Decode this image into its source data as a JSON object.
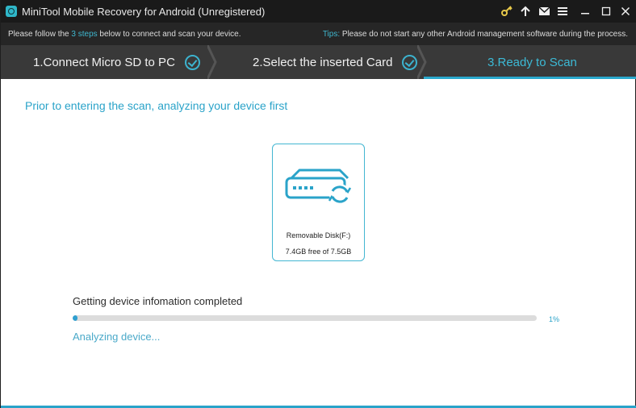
{
  "window": {
    "title": "MiniTool Mobile Recovery for Android (Unregistered)"
  },
  "titlebar_icons": [
    "key-icon",
    "upload-icon",
    "mail-icon",
    "menu-icon",
    "minimize-icon",
    "maximize-icon",
    "close-icon"
  ],
  "infobar": {
    "left_prefix": "Please follow the ",
    "left_highlight": "3 steps",
    "left_suffix": " below to connect and scan your device.",
    "tips_label": "Tips:",
    "tips_text": " Please do not start any other Android management software during the process."
  },
  "steps": [
    {
      "label": "1.Connect Micro SD to PC",
      "state": "done"
    },
    {
      "label": "2.Select the inserted Card",
      "state": "done"
    },
    {
      "label": "3.Ready to Scan",
      "state": "active"
    }
  ],
  "main": {
    "heading": "Prior to entering the scan, analyzing your device first",
    "device": {
      "name": "Removable Disk(F:)",
      "space": "7.4GB free of 7.5GB"
    },
    "status": "Getting device infomation completed",
    "progress_percent": 1,
    "progress_label": "1%",
    "analyzing": "Analyzing device..."
  },
  "colors": {
    "accent": "#2aa3c9",
    "titlebar": "#1a1a1a",
    "stepbar": "#393939"
  }
}
